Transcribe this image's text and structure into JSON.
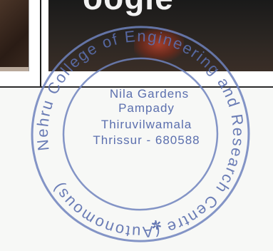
{
  "photo": {
    "headline_fragment": "oogle"
  },
  "seal": {
    "ring_text": "Nehru College of Engineering and Research Centre (Autonomous)",
    "center_lines": [
      "Nila Gardens",
      "Pampady",
      "Thiruvilwamala",
      "Thrissur - 680588"
    ],
    "star_glyph": "✲",
    "ink_color": "#5b6fae"
  }
}
